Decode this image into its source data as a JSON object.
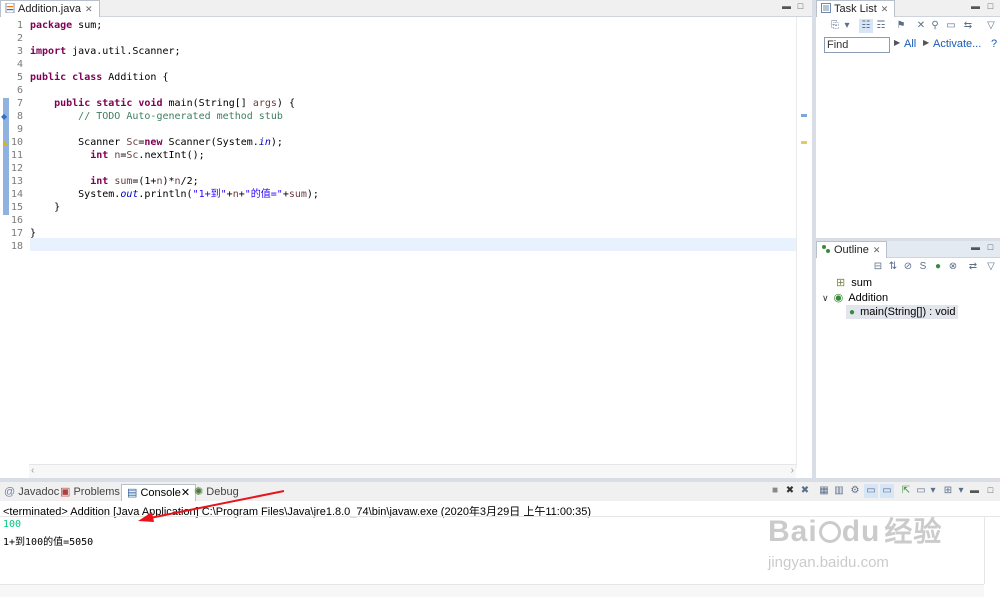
{
  "editor": {
    "tab_label": "Addition.java",
    "lines": [
      {
        "n": "1",
        "parts": [
          {
            "t": "package",
            "c": "kw"
          },
          {
            "t": " sum;",
            "c": ""
          }
        ]
      },
      {
        "n": "2",
        "parts": []
      },
      {
        "n": "3",
        "parts": [
          {
            "t": "import",
            "c": "kw"
          },
          {
            "t": " java.util.Scanner;",
            "c": ""
          }
        ]
      },
      {
        "n": "4",
        "parts": []
      },
      {
        "n": "5",
        "parts": [
          {
            "t": "public",
            "c": "kw"
          },
          {
            "t": " ",
            "c": ""
          },
          {
            "t": "class",
            "c": "kw"
          },
          {
            "t": " Addition {",
            "c": ""
          }
        ]
      },
      {
        "n": "6",
        "parts": []
      },
      {
        "n": "7",
        "parts": [
          {
            "t": "    ",
            "c": ""
          },
          {
            "t": "public",
            "c": "kw"
          },
          {
            "t": " ",
            "c": ""
          },
          {
            "t": "static",
            "c": "kw"
          },
          {
            "t": " ",
            "c": ""
          },
          {
            "t": "void",
            "c": "kw"
          },
          {
            "t": " main(String[] ",
            "c": ""
          },
          {
            "t": "args",
            "c": "var"
          },
          {
            "t": ") {",
            "c": ""
          }
        ]
      },
      {
        "n": "8",
        "parts": [
          {
            "t": "        ",
            "c": ""
          },
          {
            "t": "// TODO Auto-generated method stub",
            "c": "cm"
          }
        ]
      },
      {
        "n": "9",
        "parts": []
      },
      {
        "n": "10",
        "parts": [
          {
            "t": "        Scanner ",
            "c": ""
          },
          {
            "t": "Sc",
            "c": "var"
          },
          {
            "t": "=",
            "c": ""
          },
          {
            "t": "new",
            "c": "kw"
          },
          {
            "t": " Scanner(System.",
            "c": ""
          },
          {
            "t": "in",
            "c": "fld"
          },
          {
            "t": ");",
            "c": ""
          }
        ]
      },
      {
        "n": "11",
        "parts": [
          {
            "t": "          ",
            "c": ""
          },
          {
            "t": "int",
            "c": "kw"
          },
          {
            "t": " ",
            "c": ""
          },
          {
            "t": "n",
            "c": "var"
          },
          {
            "t": "=",
            "c": ""
          },
          {
            "t": "Sc",
            "c": "var"
          },
          {
            "t": ".nextInt();",
            "c": ""
          }
        ]
      },
      {
        "n": "12",
        "parts": []
      },
      {
        "n": "13",
        "parts": [
          {
            "t": "          ",
            "c": ""
          },
          {
            "t": "int",
            "c": "kw"
          },
          {
            "t": " ",
            "c": ""
          },
          {
            "t": "sum",
            "c": "var"
          },
          {
            "t": "=(1+",
            "c": ""
          },
          {
            "t": "n",
            "c": "var"
          },
          {
            "t": ")*",
            "c": ""
          },
          {
            "t": "n",
            "c": "var"
          },
          {
            "t": "/2;",
            "c": ""
          }
        ]
      },
      {
        "n": "14",
        "parts": [
          {
            "t": "        System.",
            "c": ""
          },
          {
            "t": "out",
            "c": "fld"
          },
          {
            "t": ".println(",
            "c": ""
          },
          {
            "t": "\"1+到\"",
            "c": "st"
          },
          {
            "t": "+",
            "c": ""
          },
          {
            "t": "n",
            "c": "var"
          },
          {
            "t": "+",
            "c": ""
          },
          {
            "t": "\"的值=\"",
            "c": "st"
          },
          {
            "t": "+",
            "c": ""
          },
          {
            "t": "sum",
            "c": "var"
          },
          {
            "t": ");",
            "c": ""
          }
        ]
      },
      {
        "n": "15",
        "parts": [
          {
            "t": "    }",
            "c": ""
          }
        ]
      },
      {
        "n": "16",
        "parts": []
      },
      {
        "n": "17",
        "parts": [
          {
            "t": "}",
            "c": ""
          }
        ]
      },
      {
        "n": "18",
        "parts": []
      }
    ]
  },
  "tasklist": {
    "title": "Task List",
    "find_placeholder": "Find",
    "all_label": "All",
    "activate_label": "Activate...",
    "help_label": "?"
  },
  "outline": {
    "title": "Outline",
    "package": "sum",
    "class": "Addition",
    "method": "main(String[]) : void"
  },
  "console": {
    "tabs": {
      "javadoc": "Javadoc",
      "problems": "Problems",
      "console": "Console",
      "debug": "Debug"
    },
    "header": "<terminated> Addition [Java Application] C:\\Program Files\\Java\\jre1.8.0_74\\bin\\javaw.exe (2020年3月29日 上午11:00:35)",
    "input_line": "100",
    "output_line": "1+到100的值=5050",
    "input_color": "#00c87f",
    "arrow_color": "#e8141c"
  },
  "watermark": {
    "brand": "Bai",
    "brand2": "du",
    "cn": "经验",
    "url": "jingyan.baidu.com"
  }
}
